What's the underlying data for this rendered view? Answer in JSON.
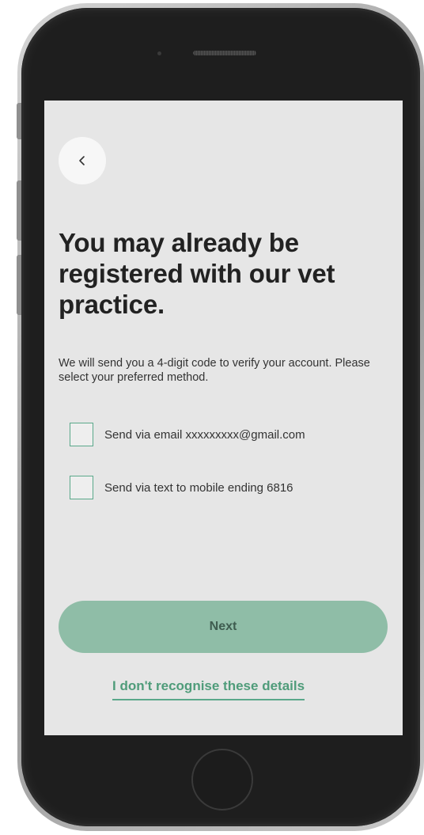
{
  "screen": {
    "back_icon": "chevron-left-icon",
    "heading": "You may already be registered with our vet practice.",
    "subtitle": "We will send you a 4-digit code to verify your account. Please select your preferred method.",
    "options": [
      {
        "label": "Send via email xxxxxxxxx@gmail.com",
        "checked": false
      },
      {
        "label": "Send via text to mobile ending 6816",
        "checked": false
      }
    ],
    "next_label": "Next",
    "link_label": "I don't recognise these details"
  },
  "colors": {
    "accent": "#5aa88a",
    "button_bg": "#8fbda7",
    "screen_bg": "#e6e6e6",
    "text": "#222222"
  }
}
